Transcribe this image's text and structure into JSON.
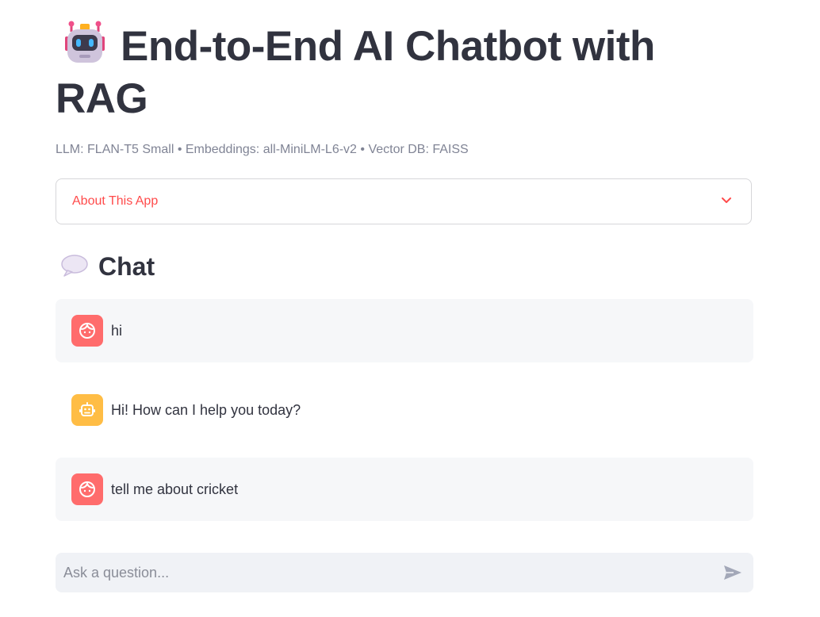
{
  "header": {
    "title": "End-to-End AI Chatbot with RAG",
    "title_icon": "robot-icon",
    "subtitle": "LLM: FLAN-T5 Small • Embeddings: all-MiniLM-L6-v2 • Vector DB: FAISS"
  },
  "expander": {
    "label": "About This App",
    "icon": "chevron-down-icon",
    "expanded": false
  },
  "chat": {
    "heading": "Chat",
    "heading_icon": "speech-bubble-icon",
    "messages": [
      {
        "role": "user",
        "text": "hi"
      },
      {
        "role": "assistant",
        "text": "Hi! How can I help you today?"
      },
      {
        "role": "user",
        "text": "tell me about cricket"
      }
    ],
    "input": {
      "placeholder": "Ask a question...",
      "value": ""
    },
    "send_icon": "send-icon"
  },
  "colors": {
    "accent": "#ff4b4b",
    "user_avatar": "#ff6c6c",
    "assistant_avatar": "#ffbd45",
    "text": "#31333f",
    "muted": "#808495"
  }
}
